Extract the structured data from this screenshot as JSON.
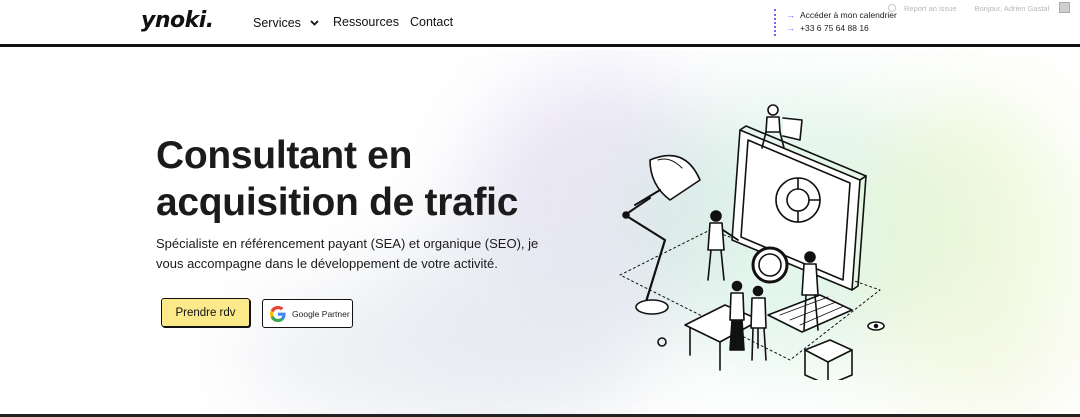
{
  "header": {
    "logo_text": "ynoki.",
    "nav": {
      "services": "Services",
      "ressources": "Ressources",
      "contact": "Contact"
    },
    "contact": {
      "calendar": "Accéder à mon calendrier",
      "phone": "+33 6 75 64 88 16"
    },
    "admin_bar": {
      "report": "Report an issue",
      "user": "Bonjour, Adrien Gastal"
    }
  },
  "hero": {
    "headline_line1": "Consultant en",
    "headline_line2": "acquisition de trafic",
    "subtext": "Spécialiste en référencement payant (SEA) et organique (SEO), je vous accompagne dans le développement de votre activité.",
    "cta_label": "Prendre rdv",
    "badge_label": "Google Partner"
  },
  "colors": {
    "accent_purple": "#7b5cff",
    "cta_yellow": "#fbe98a",
    "text_dark": "#1b1b1b"
  },
  "icons": [
    "chevron-down-icon",
    "arrow-right-icon",
    "google-g-icon",
    "avatar-icon",
    "report-icon",
    "isometric-office-illustration"
  ]
}
